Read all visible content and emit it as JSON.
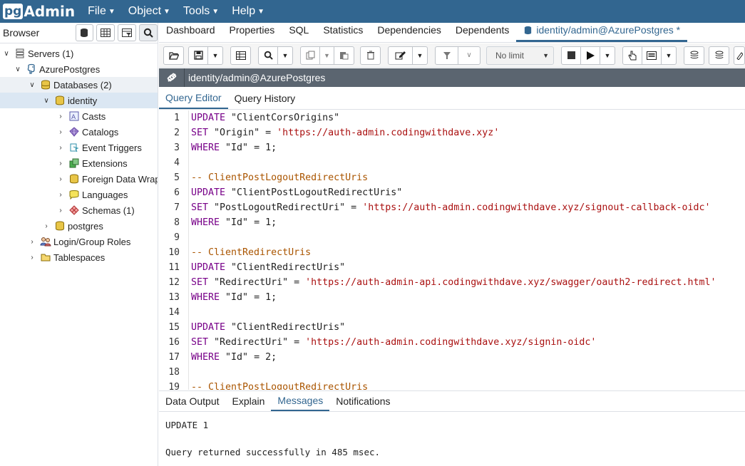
{
  "app": {
    "logo_pg": "pg",
    "logo_admin": "Admin",
    "menus": [
      "File",
      "Object",
      "Tools",
      "Help"
    ]
  },
  "browser": {
    "title": "Browser",
    "tree": [
      {
        "label": "Servers (1)",
        "icon": "servers-icon"
      },
      {
        "label": "AzurePostgres",
        "icon": "postgres-server-icon"
      },
      {
        "label": "Databases (2)",
        "icon": "databases-icon"
      },
      {
        "label": "identity",
        "icon": "database-icon"
      },
      {
        "label": "Casts",
        "icon": "casts-icon"
      },
      {
        "label": "Catalogs",
        "icon": "catalogs-icon"
      },
      {
        "label": "Event Triggers",
        "icon": "event-triggers-icon"
      },
      {
        "label": "Extensions",
        "icon": "extensions-icon"
      },
      {
        "label": "Foreign Data Wrap",
        "icon": "foreign-data-wrapper-icon"
      },
      {
        "label": "Languages",
        "icon": "languages-icon"
      },
      {
        "label": "Schemas (1)",
        "icon": "schemas-icon"
      },
      {
        "label": "postgres",
        "icon": "database-icon"
      },
      {
        "label": "Login/Group Roles",
        "icon": "roles-icon"
      },
      {
        "label": "Tablespaces",
        "icon": "tablespaces-icon"
      }
    ]
  },
  "tabs": [
    "Dashboard",
    "Properties",
    "SQL",
    "Statistics",
    "Dependencies",
    "Dependents",
    "identity/admin@AzurePostgres *"
  ],
  "toolbar": {
    "limit_value": "No limit"
  },
  "connection": {
    "title": "identity/admin@AzurePostgres"
  },
  "editor_tabs": [
    "Query Editor",
    "Query History"
  ],
  "editor": {
    "line_numbers": [
      "1",
      "2",
      "3",
      "4",
      "5",
      "6",
      "7",
      "8",
      "9",
      "10",
      "11",
      "12",
      "13",
      "14",
      "15",
      "16",
      "17",
      "18",
      "19"
    ],
    "lines": [
      [
        {
          "t": "kw",
          "v": "UPDATE"
        },
        {
          "t": "p",
          "v": " \"ClientCorsOrigins\""
        }
      ],
      [
        {
          "t": "kw",
          "v": "SET"
        },
        {
          "t": "p",
          "v": " \"Origin\" = "
        },
        {
          "t": "str",
          "v": "'https://auth-admin.codingwithdave.xyz'"
        }
      ],
      [
        {
          "t": "kw",
          "v": "WHERE"
        },
        {
          "t": "p",
          "v": " \"Id\" = 1;"
        }
      ],
      [],
      [
        {
          "t": "cm",
          "v": "-- ClientPostLogoutRedirectUris"
        }
      ],
      [
        {
          "t": "kw",
          "v": "UPDATE"
        },
        {
          "t": "p",
          "v": " \"ClientPostLogoutRedirectUris\""
        }
      ],
      [
        {
          "t": "kw",
          "v": "SET"
        },
        {
          "t": "p",
          "v": " \"PostLogoutRedirectUri\" = "
        },
        {
          "t": "str",
          "v": "'https://auth-admin.codingwithdave.xyz/signout-callback-oidc'"
        }
      ],
      [
        {
          "t": "kw",
          "v": "WHERE"
        },
        {
          "t": "p",
          "v": " \"Id\" = 1;"
        }
      ],
      [],
      [
        {
          "t": "cm",
          "v": "-- ClientRedirectUris"
        }
      ],
      [
        {
          "t": "kw",
          "v": "UPDATE"
        },
        {
          "t": "p",
          "v": " \"ClientRedirectUris\""
        }
      ],
      [
        {
          "t": "kw",
          "v": "SET"
        },
        {
          "t": "p",
          "v": " \"RedirectUri\" = "
        },
        {
          "t": "str",
          "v": "'https://auth-admin-api.codingwithdave.xyz/swagger/oauth2-redirect.html'"
        }
      ],
      [
        {
          "t": "kw",
          "v": "WHERE"
        },
        {
          "t": "p",
          "v": " \"Id\" = 1;"
        }
      ],
      [],
      [
        {
          "t": "kw",
          "v": "UPDATE"
        },
        {
          "t": "p",
          "v": " \"ClientRedirectUris\""
        }
      ],
      [
        {
          "t": "kw",
          "v": "SET"
        },
        {
          "t": "p",
          "v": " \"RedirectUri\" = "
        },
        {
          "t": "str",
          "v": "'https://auth-admin.codingwithdave.xyz/signin-oidc'"
        }
      ],
      [
        {
          "t": "kw",
          "v": "WHERE"
        },
        {
          "t": "p",
          "v": " \"Id\" = 2;"
        }
      ],
      [],
      [
        {
          "t": "cm",
          "v": "-- ClientPostLogoutRedirectUris"
        }
      ]
    ]
  },
  "result_tabs": [
    "Data Output",
    "Explain",
    "Messages",
    "Notifications"
  ],
  "messages": {
    "line1": "UPDATE 1",
    "line2": "",
    "line3": "Query returned successfully in 485 msec."
  }
}
